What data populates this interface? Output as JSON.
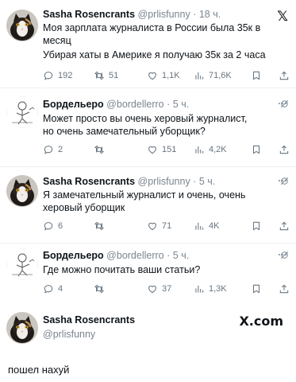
{
  "tweets": [
    {
      "name": "Sasha Rosencrants",
      "handle": "@prlisfunny",
      "time": "18 ч.",
      "lines": [
        "Моя зарплата журналиста в России была 35к в",
        "месяц",
        "Убирая хаты в Америке я получаю 35к за 2 часа"
      ],
      "replies": "192",
      "retweets": "51",
      "likes": "1,1K",
      "views": "71,6K",
      "avatar": "cat"
    },
    {
      "name": "Бордельеро",
      "handle": "@bordellerro",
      "time": "5 ч.",
      "lines": [
        "Может просто вы очень херовый журналист,",
        "но очень замечательный уборщик?"
      ],
      "replies": "2",
      "retweets": "",
      "likes": "151",
      "views": "4,2K",
      "avatar": "doodle"
    },
    {
      "name": "Sasha Rosencrants",
      "handle": "@prlisfunny",
      "time": "5 ч.",
      "lines": [
        "Я замечательный журналист и очень, очень",
        "херовый уборщик"
      ],
      "replies": "6",
      "retweets": "",
      "likes": "71",
      "views": "4K",
      "avatar": "cat"
    },
    {
      "name": "Бордельеро",
      "handle": "@bordellerro",
      "time": "5 ч.",
      "lines": [
        "Где можно почитать ваши статьи?"
      ],
      "replies": "4",
      "retweets": "",
      "likes": "37",
      "views": "1,3K",
      "avatar": "doodle"
    }
  ],
  "footer": {
    "name": "Sasha Rosencrants",
    "handle": "@prlisfunny",
    "brand": "X.com"
  },
  "caption": "пошел нахуй",
  "icons": {
    "x_logo": "𝕏",
    "grok": "grok-icon",
    "more": "more-icon"
  },
  "colors": {
    "text": "#0f1419",
    "muted": "#687580"
  }
}
